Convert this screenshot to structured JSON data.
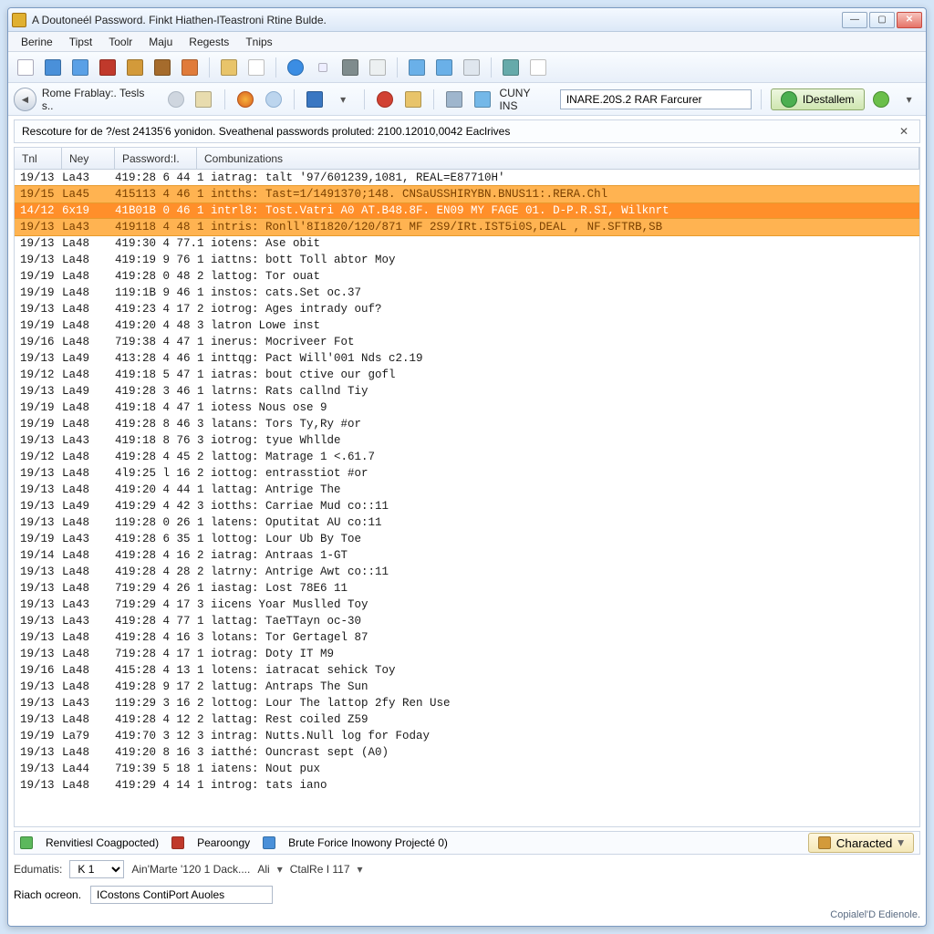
{
  "window": {
    "title": "A Doutoneél Password. Finkt Hiathen-lTeastroni Rtine Bulde."
  },
  "menubar": [
    "Berine",
    "Tipst",
    "Toolr",
    "Maju",
    "Regests",
    "Tnips"
  ],
  "toolbar2": {
    "nav_label": "Rome Frablay:. Tesls s..",
    "cuny_label": "CUNY INS",
    "search_value": "INARE.20S.2 RAR Farcurer",
    "install_label": "IDestallem"
  },
  "infoline": "Rescoture for de ?/est 24135'6 yonidon. Sveathenal passwords proluted: 2100.12010,0042 Eaclrives",
  "columns": [
    "Tnl",
    "Ney",
    "Password:I.",
    "Combunizations"
  ],
  "rows": [
    {
      "c0": "19/13",
      "c1": "La43",
      "c2": "419:28 6 44",
      "c3": "1 iatrag: talt '97/601239,1081, REAL=E87710H'"
    },
    {
      "c0": "19/15",
      "c1": "La45",
      "c2": "415113 4 46",
      "c3": "1 intths: Tast=1/1491370;148. CNSaUSSHIRYBN.BNUS11:.RERA.Chl",
      "hl": 1
    },
    {
      "c0": "14/12",
      "c1": "6x19",
      "c2": "41B01B 0 46",
      "c3": "1 intrl8: Tost.Vatri A0 AT.B48.8F. EN09 MY FAGE 01. D-P.R.SI, Wilknrt",
      "hl": 2
    },
    {
      "c0": "19/13",
      "c1": "La43",
      "c2": "419118 4 48",
      "c3": "1 intris: Ronll'8I1820/120/871 MF 2S9/IRt.IST5i0S,DEAL , NF.SFTRB,SB",
      "hl": 1
    },
    {
      "c0": "19/13",
      "c1": "La48",
      "c2": "419:30 4 77.",
      "c3": "1 iotens: Ase obit"
    },
    {
      "c0": "19/13",
      "c1": "La48",
      "c2": "419:19 9 76",
      "c3": "1 iattns: bott Toll abtor Moy"
    },
    {
      "c0": "19/19",
      "c1": "La48",
      "c2": "419:28 0 48",
      "c3": "2 lattog: Tor ouat"
    },
    {
      "c0": "19/19",
      "c1": "La48",
      "c2": "119:1B 9 46",
      "c3": "1 instos: cats.Set oc.37"
    },
    {
      "c0": "19/13",
      "c1": "La48",
      "c2": "419:23 4 17",
      "c3": "2 iotrog: Ages intrady ouf?"
    },
    {
      "c0": "19/19",
      "c1": "La48",
      "c2": "419:20 4 48",
      "c3": "3 latron Lowe inst"
    },
    {
      "c0": "19/16",
      "c1": "La48",
      "c2": "719:38 4 47",
      "c3": "1 inerus: Mocriveer Fot"
    },
    {
      "c0": "19/13",
      "c1": "La49",
      "c2": "413:28 4 46",
      "c3": "1 inttqg: Pact Will'001 Nds c2.19"
    },
    {
      "c0": "19/12",
      "c1": "La48",
      "c2": "419:18 5 47",
      "c3": "1 iatras: bout ctive our gofl"
    },
    {
      "c0": "19/13",
      "c1": "La49",
      "c2": "419:28 3 46",
      "c3": "1 latrns: Rats callnd Tiy"
    },
    {
      "c0": "19/19",
      "c1": "La48",
      "c2": "419:18 4 47",
      "c3": "1 iotess Nous ose 9"
    },
    {
      "c0": "19/19",
      "c1": "La48",
      "c2": "419:28 8 46",
      "c3": "3 latans: Tors Ty,Ry #or"
    },
    {
      "c0": "19/13",
      "c1": "La43",
      "c2": "419:18 8 76",
      "c3": "3 iotrog: tyue Whllde"
    },
    {
      "c0": "19/12",
      "c1": "La48",
      "c2": "419:28 4 45",
      "c3": "2 lattog: Matrage 1 <.61.7"
    },
    {
      "c0": "19/13",
      "c1": "La48",
      "c2": "4l9:25 l 16",
      "c3": "2 iottog: entrasstiot #or"
    },
    {
      "c0": "19/13",
      "c1": "La48",
      "c2": "419:20 4 44",
      "c3": "1 lattag: Antrige The"
    },
    {
      "c0": "19/13",
      "c1": "La49",
      "c2": "419:29 4 42",
      "c3": "3 iotths: Carriae Mud co::11"
    },
    {
      "c0": "19/13",
      "c1": "La48",
      "c2": "119:28 0 26",
      "c3": "1 latens: Oputitat AU co:11"
    },
    {
      "c0": "19/19",
      "c1": "La43",
      "c2": "419:28 6 35",
      "c3": "1 lottog: Lour Ub By Toe"
    },
    {
      "c0": "19/14",
      "c1": "La48",
      "c2": "419:28 4 16",
      "c3": "2 iatrag: Antraas 1-GT"
    },
    {
      "c0": "19/13",
      "c1": "La48",
      "c2": "419:28 4 28",
      "c3": "2 latrny: Antrige Awt co::11"
    },
    {
      "c0": "19/13",
      "c1": "La48",
      "c2": "719:29 4 26",
      "c3": "1 iastag: Lost 78E6 11"
    },
    {
      "c0": "19/13",
      "c1": "La43",
      "c2": "719:29 4 17",
      "c3": "3 iicens Yoar Muslled Toy"
    },
    {
      "c0": "19/13",
      "c1": "La43",
      "c2": "419:28 4 77",
      "c3": "1 lattag: TaeTTayn oc-30"
    },
    {
      "c0": "19/13",
      "c1": "La48",
      "c2": "419:28 4 16",
      "c3": "3 lotans: Tor Gertagel 87"
    },
    {
      "c0": "19/13",
      "c1": "La48",
      "c2": "719:28 4 17",
      "c3": "1 iotrag: Doty IT M9"
    },
    {
      "c0": "19/16",
      "c1": "La48",
      "c2": "415:28 4 13",
      "c3": "1 lotens: iatracat sehick Toy"
    },
    {
      "c0": "19/13",
      "c1": "La48",
      "c2": "419:28 9 17",
      "c3": "2 lattug: Antraps The Sun"
    },
    {
      "c0": "19/13",
      "c1": "La43",
      "c2": "119:29 3 16",
      "c3": "2 lottog: Lour The lattop 2fy Ren Use"
    },
    {
      "c0": "19/13",
      "c1": "La48",
      "c2": "419:28 4 12",
      "c3": "2 lattag: Rest coiled Z59"
    },
    {
      "c0": "19/19",
      "c1": "La79",
      "c2": "419:70 3 12",
      "c3": "3 intrag: Nutts.Null log for Foday"
    },
    {
      "c0": "19/13",
      "c1": "La48",
      "c2": "419:20 8 16",
      "c3": "3 iatthé: Ouncrast sept (A0)"
    },
    {
      "c0": "19/13",
      "c1": "La44",
      "c2": "719:39 5 18",
      "c3": "1 iatens: Nout pux"
    },
    {
      "c0": "19/13",
      "c1": "La48",
      "c2": "419:29 4 14",
      "c3": "1 introg: tats iano"
    }
  ],
  "status": {
    "connected": "Renvitiesl Coagpocted)",
    "recovery": "Pearoongy",
    "brute": "Brute Forice Inowony Projecté 0)",
    "right_btn": "Characted"
  },
  "lower": {
    "edumatis": "Edumatis:",
    "sel1": "K 1",
    "label2": "Ain'Marte '120 1 Dack....",
    "label2b": "Ali",
    "label3": "CtalRe I 117"
  },
  "lower2": {
    "left": "Riach ocreon.",
    "input": "ICostons ContiPort Auoles"
  },
  "foot": "Copialel'D Edienole."
}
